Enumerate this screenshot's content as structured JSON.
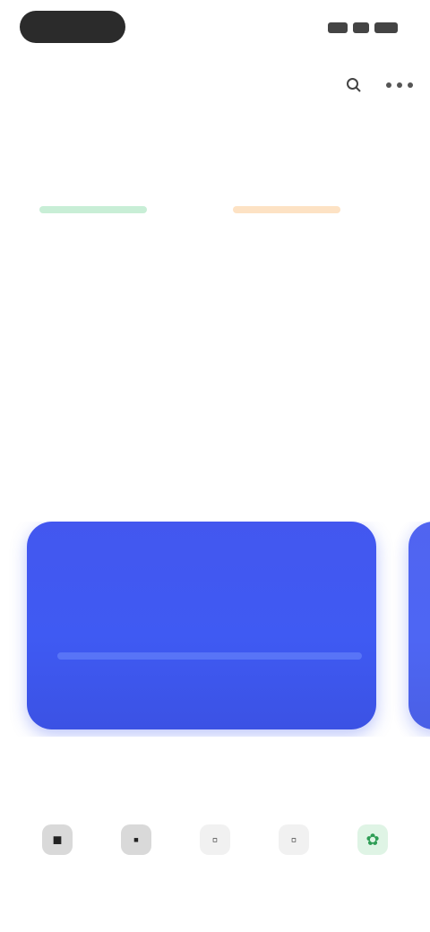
{
  "status_bar": {
    "time_pill": "",
    "right_icons": [
      "signal-icon",
      "wifi-icon",
      "battery-icon"
    ]
  },
  "header": {
    "title": "",
    "icons": [
      "search-icon",
      "more-icon"
    ]
  },
  "tabs": [
    {
      "label": "",
      "active": true
    },
    {
      "label": "",
      "active": false
    },
    {
      "label": "",
      "active": false
    },
    {
      "label": "",
      "active": false
    }
  ],
  "summary": [
    {
      "accent": "#c8eed6",
      "value": "",
      "sub": ""
    },
    {
      "accent": "#fde2c4",
      "value": "",
      "sub": ""
    }
  ],
  "sections": {
    "featured": "",
    "shortcuts": ""
  },
  "promo": {
    "accent": "#4357ef",
    "title": "",
    "text": ""
  },
  "shortcuts": [
    {
      "icon": "square-icon",
      "label": ""
    },
    {
      "icon": "square-icon",
      "label": ""
    },
    {
      "icon": "square-icon",
      "label": ""
    },
    {
      "icon": "square-icon",
      "label": ""
    },
    {
      "icon": "leaf-icon",
      "label": ""
    }
  ]
}
